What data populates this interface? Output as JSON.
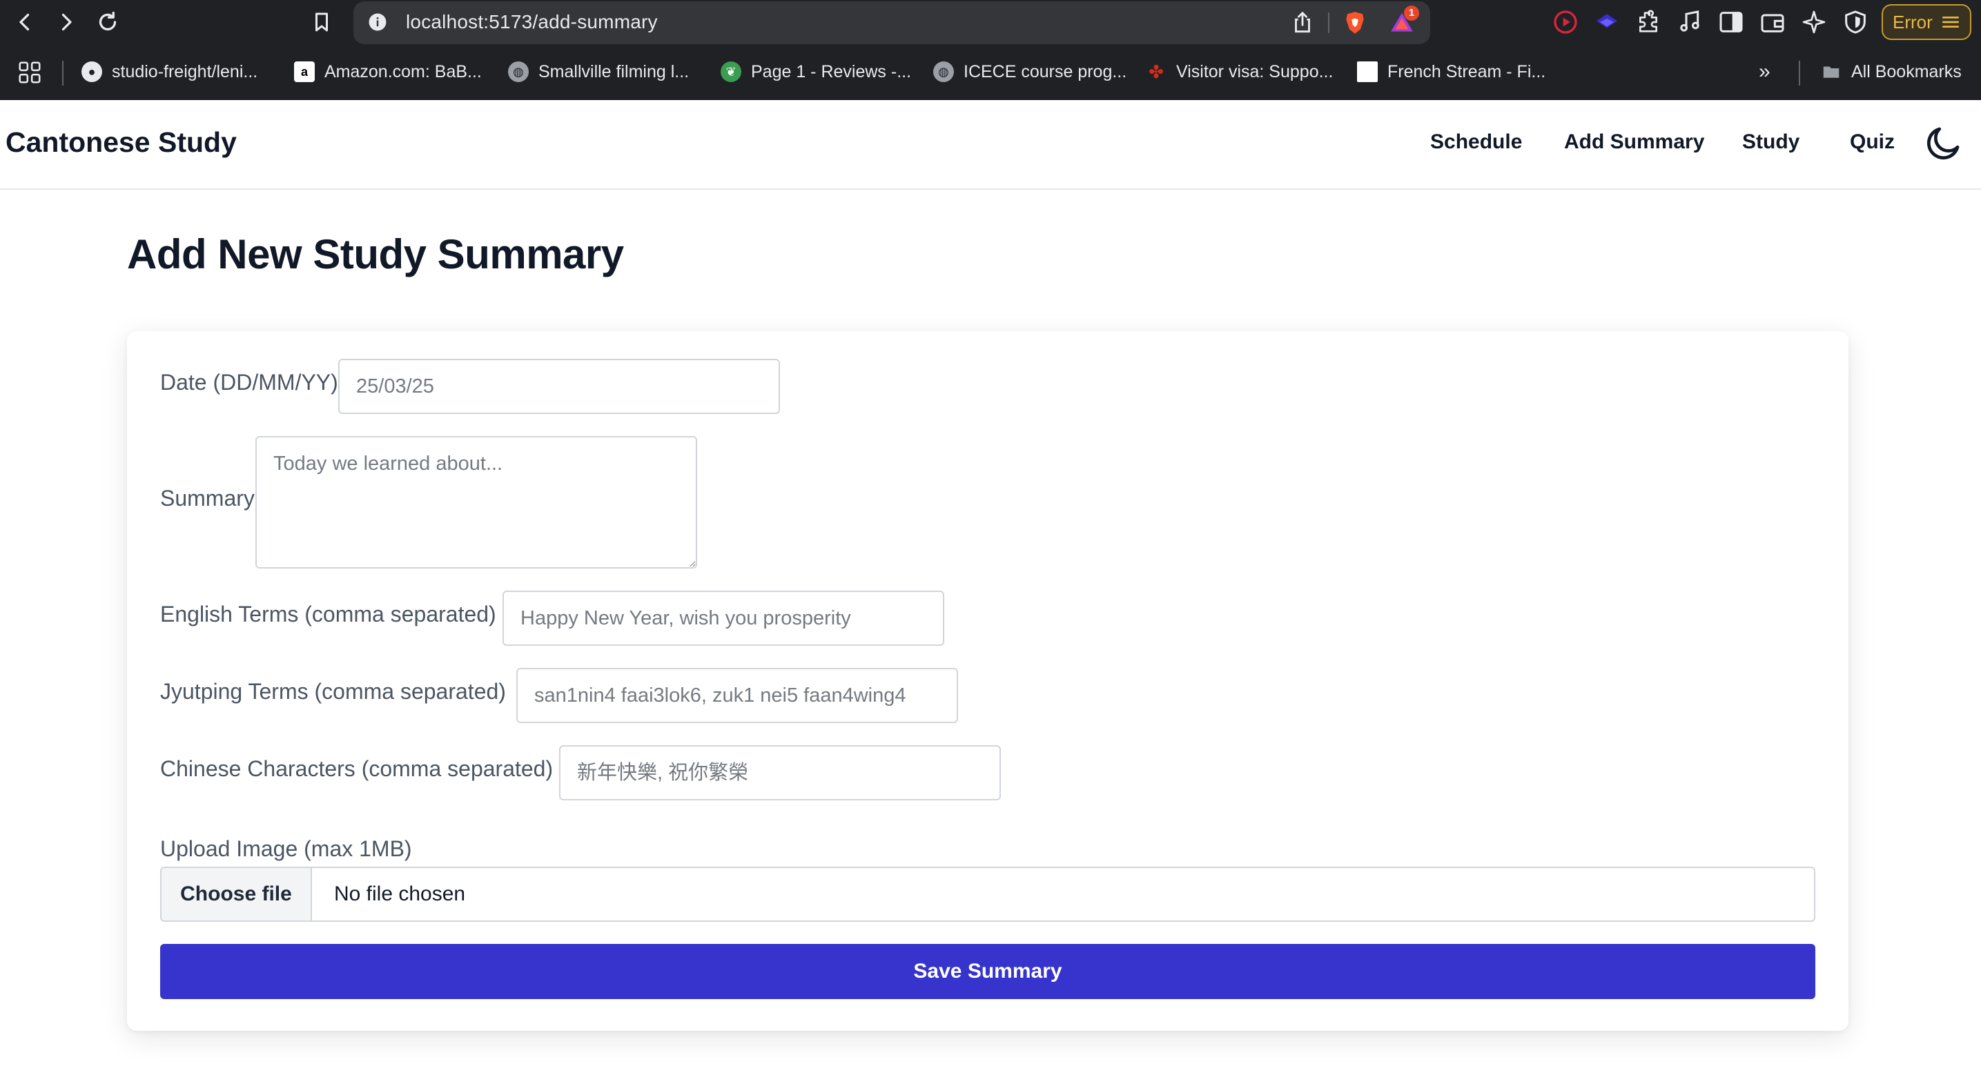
{
  "browser": {
    "url": "localhost:5173/add-summary",
    "notification_count": "1",
    "error_label": "Error",
    "bookmarks": [
      {
        "label": "studio-freight/leni..."
      },
      {
        "label": "Amazon.com: BaB..."
      },
      {
        "label": "Smallville filming l..."
      },
      {
        "label": "Page 1 - Reviews -..."
      },
      {
        "label": "ICECE course prog..."
      },
      {
        "label": "Visitor visa: Suppo..."
      },
      {
        "label": "French Stream - Fi..."
      }
    ],
    "all_bookmarks_label": "All Bookmarks",
    "overflow_label": "»"
  },
  "header": {
    "brand": "Cantonese Study",
    "nav": [
      "Schedule",
      "Add Summary",
      "Study",
      "Quiz"
    ]
  },
  "page": {
    "title": "Add New Study Summary"
  },
  "form": {
    "date_label": "Date (DD/MM/YY)",
    "date_placeholder": "25/03/25",
    "summary_label": "Summary",
    "summary_placeholder": "Today we learned about...",
    "english_label": "English Terms (comma separated)",
    "english_placeholder": "Happy New Year, wish you prosperity",
    "jyutping_label": "Jyutping Terms (comma separated)",
    "jyutping_placeholder": "san1nin4 faai3lok6, zuk1 nei5 faan4wing4",
    "chinese_label": "Chinese Characters (comma separated)",
    "chinese_placeholder": "新年快樂, 祝你繁榮",
    "upload_label": "Upload Image (max 1MB)",
    "choose_file_label": "Choose file",
    "no_file_label": "No file chosen",
    "save_label": "Save Summary"
  },
  "colors": {
    "primary": "#3634cc",
    "chrome_bg": "#202124",
    "error_accent": "#e9b84a"
  }
}
